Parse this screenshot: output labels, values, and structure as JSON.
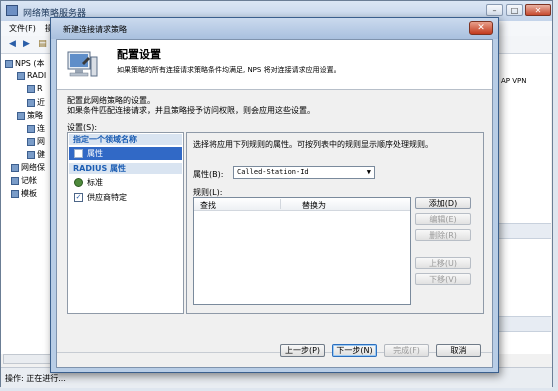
{
  "background_window": {
    "title": "网络策略服务器",
    "menu": [
      "文件(F)",
      "操"
    ],
    "tree": [
      "NPS (本",
      "RADI",
      "R",
      "近",
      "策略",
      "连",
      "网",
      "健",
      "网络保",
      "记帐",
      "模板"
    ],
    "right_text": "AP VPN",
    "status": "操作: 正在进行..."
  },
  "dialog": {
    "title": "新建连接请求策略",
    "header_title": "配置设置",
    "header_desc": "如果策略的所有连接请求策略条件均满足, NPS 将对连接请求应用设置。",
    "intro_line1": "配置此网络策略的设置。",
    "intro_line2": "如果条件匹配连接请求，并且策略授予访问权限，则会应用这些设置。",
    "settings_label": "设置(S):",
    "left_pane": {
      "group1": "指定一个领域名称",
      "item_attr": "属性",
      "group2": "RADIUS 属性",
      "item_standard": "标准",
      "item_vendor": "供应商特定"
    },
    "right_pane": {
      "description": "选择将应用下列规则的属性。可按列表中的规则显示顺序处理规则。",
      "attr_label": "属性(B):",
      "attr_value": "Called-Station-Id",
      "rules_label": "规则(L):",
      "col_find": "查找",
      "col_replace": "替换为",
      "btn_add": "添加(D)",
      "btn_edit": "编辑(E)",
      "btn_delete": "删除(R)",
      "btn_up": "上移(U)",
      "btn_down": "下移(V)"
    },
    "footer": {
      "prev": "上一步(P)",
      "next": "下一步(N)",
      "finish": "完成(F)",
      "cancel": "取消"
    }
  }
}
